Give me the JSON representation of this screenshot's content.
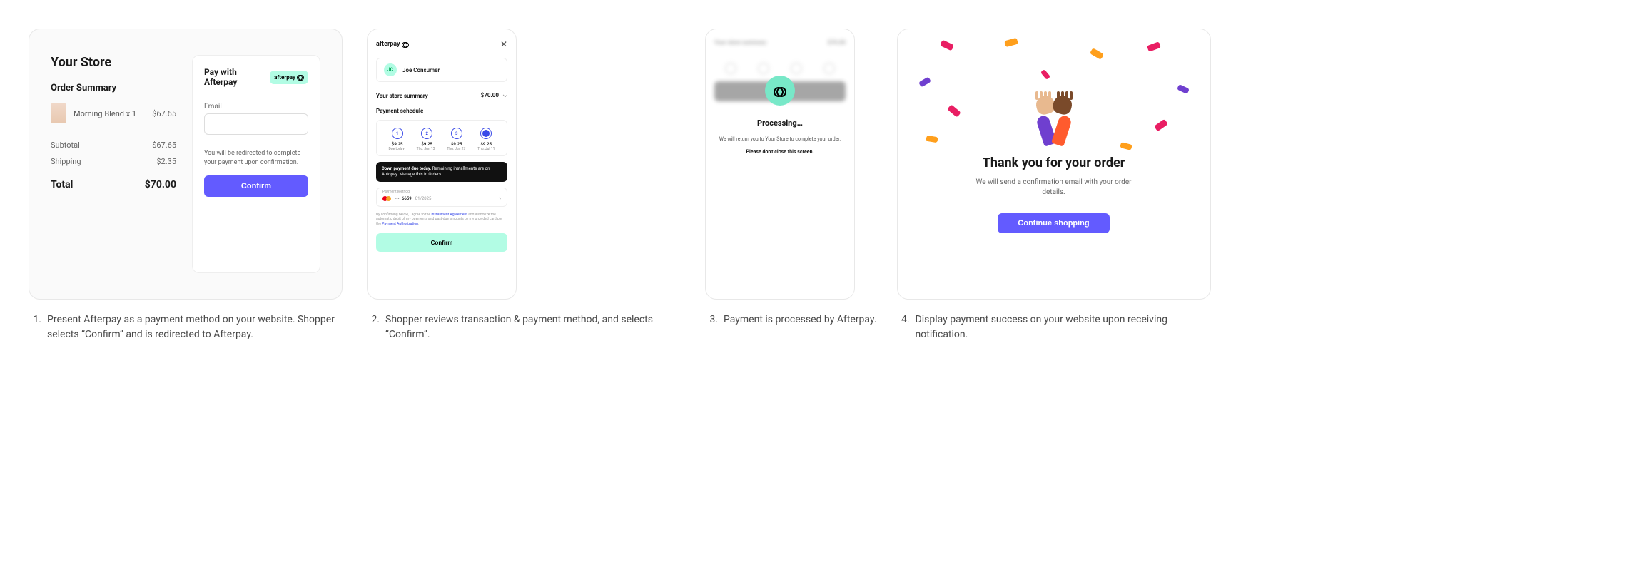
{
  "screen1": {
    "store_name": "Your Store",
    "summary_heading": "Order Summary",
    "item_name": "Morning Blend x 1",
    "item_price": "$67.65",
    "subtotal_label": "Subtotal",
    "subtotal_value": "$67.65",
    "shipping_label": "Shipping",
    "shipping_value": "$2.35",
    "total_label": "Total",
    "total_value": "$70.00",
    "pay_heading": "Pay with Afterpay",
    "afterpay_badge": "afterpay",
    "email_label": "Email",
    "redirect_text": "You will be redirected to complete your payment upon confirmation.",
    "confirm_button": "Confirm"
  },
  "screen2": {
    "logo": "afterpay",
    "avatar_initials": "JC",
    "user_name": "Joe Consumer",
    "summary_label": "Your store summary",
    "summary_amount": "$70.00",
    "schedule_heading": "Payment schedule",
    "installments": [
      {
        "n": "1",
        "amount": "$9.25",
        "date": "Due today"
      },
      {
        "n": "2",
        "amount": "$9.25",
        "date": "Thu, Jun 13"
      },
      {
        "n": "3",
        "amount": "$9.25",
        "date": "Thu, Jun 27"
      },
      {
        "n": "4",
        "amount": "$9.25",
        "date": "Thu, Jul 11"
      }
    ],
    "banner_bold": "Down payment due today.",
    "banner_rest": " Remaining installments are on Autopay. Manage this in Orders.",
    "pm_label": "Payment Method",
    "pm_card": "•••• 6659",
    "pm_exp": "01/2025",
    "legal_pre": "By confirming below, I agree to the ",
    "legal_link1": "Installment Agreement",
    "legal_mid": " and authorize the automatic debit of my payments and past-due amounts by my provided card per the ",
    "legal_link2": "Payment Authorization",
    "confirm_button": "Confirm"
  },
  "screen3": {
    "blur_summary": "Your store summary",
    "blur_amount": "$70.00",
    "processing": "Processing…",
    "message": "We will return you to Your Store to complete your order.",
    "warning": "Please don't close this screen."
  },
  "screen4": {
    "title": "Thank you for your order",
    "message": "We will send a confirmation email with your order details.",
    "button": "Continue shopping"
  },
  "captions": [
    {
      "n": "1.",
      "text": "Present Afterpay as a payment method on your website. Shopper selects “Confirm” and is redirected to Afterpay."
    },
    {
      "n": "2.",
      "text": "Shopper reviews transaction & payment method, and selects “Confirm”."
    },
    {
      "n": "3.",
      "text": "Payment is processed by Afterpay."
    },
    {
      "n": "4.",
      "text": "Display payment success on your website upon receiving notification."
    }
  ]
}
